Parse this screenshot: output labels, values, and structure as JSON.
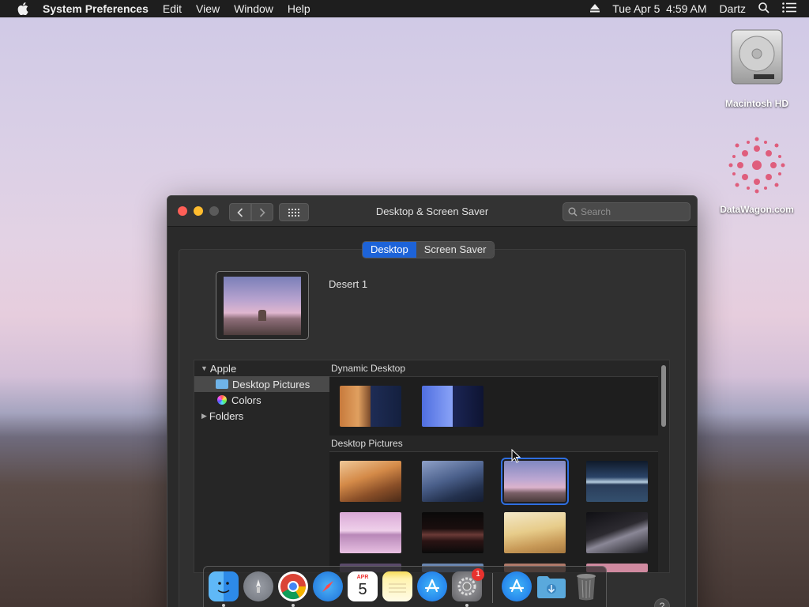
{
  "menubar": {
    "app_name": "System Preferences",
    "items": [
      "Edit",
      "View",
      "Window",
      "Help"
    ],
    "clock": "Tue Apr 5  4:59 AM",
    "user": "Dartz",
    "icons": [
      "apple-icon",
      "eject-icon",
      "search-icon",
      "list-icon"
    ]
  },
  "desktop": {
    "icons": [
      {
        "label": "Macintosh HD",
        "icon": "hard-drive-icon"
      },
      {
        "label": "DataWagon.com",
        "icon": "datawagon-logo-icon"
      }
    ]
  },
  "window": {
    "title": "Desktop & Screen Saver",
    "search_placeholder": "Search",
    "tabs": [
      {
        "label": "Desktop",
        "active": true
      },
      {
        "label": "Screen Saver",
        "active": false
      }
    ],
    "current_picture": "Desert 1",
    "sidebar": {
      "apple_label": "Apple",
      "desktop_pictures_label": "Desktop Pictures",
      "colors_label": "Colors",
      "folders_label": "Folders"
    },
    "sections": {
      "dynamic_title": "Dynamic Desktop",
      "pictures_title": "Desktop Pictures"
    },
    "help_label": "?",
    "selected_thumbnail": "desert-1"
  },
  "dock": {
    "apps": [
      "Finder",
      "Launchpad",
      "Chrome",
      "Safari",
      "Calendar",
      "Notes",
      "App Store",
      "System Preferences",
      "App Store",
      "Downloads",
      "Trash"
    ],
    "calendar": {
      "month": "APR",
      "day": "5"
    },
    "badge": "1"
  },
  "colors": {
    "accent": "#1d63d8",
    "window_bg": "#2a2a2a",
    "menubar_bg": "#1e1e1e"
  }
}
